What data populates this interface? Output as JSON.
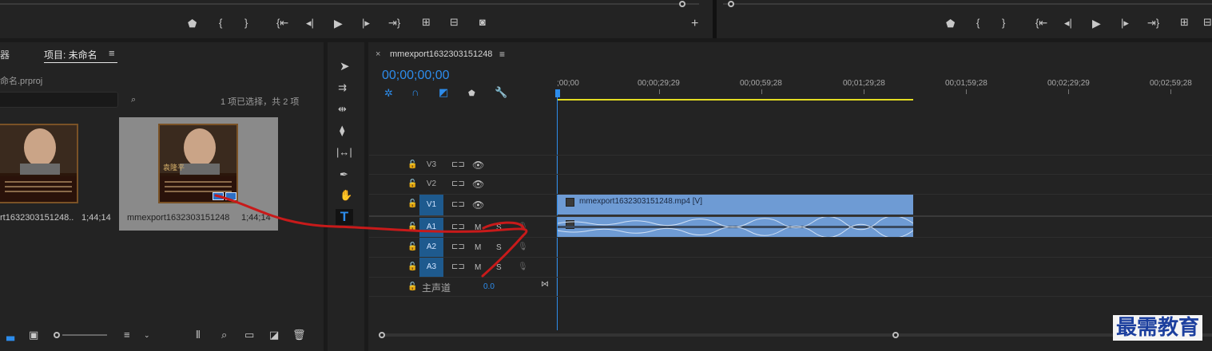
{
  "project_panel": {
    "tab_left_partial": "器",
    "tab_project": "项目: 未命名",
    "menu_icon": "≡",
    "project_file": "命名.prproj",
    "selection_info": "1 项已选择，共 2 项",
    "clips": [
      {
        "name": "rt1632303151248...",
        "duration": "1;44;14"
      },
      {
        "name": "mmexport1632303151248",
        "duration": "1;44;14"
      }
    ],
    "thumb_caption": "袁隆平"
  },
  "sequence": {
    "close_icon": "×",
    "name": "mmexport1632303151248",
    "menu_icon": "≡",
    "timecode": "00;00;00;00",
    "ruler_labels": [
      ";00;00",
      "00;00;29;29",
      "00;00;59;28",
      "00;01;29;28",
      "00;01;59;28",
      "00;02;29;29",
      "00;02;59;28"
    ],
    "tracks": {
      "v3": "V3",
      "v2": "V2",
      "v1": "V1",
      "a1": "A1",
      "a2": "A2",
      "a3": "A3",
      "master_label": "主声道",
      "master_value": "0.0",
      "mute": "M",
      "solo": "S"
    },
    "video_clip_label": "mmexport1632303151248.mp4 [V]"
  },
  "watermark": "最需教育",
  "colors": {
    "accent_blue": "#2d8ceb",
    "clip_blue": "#6e9bd4",
    "track_on": "#1e5a8e",
    "in_out_yellow": "#e3dc22",
    "annotation_red": "#c81a1a"
  }
}
